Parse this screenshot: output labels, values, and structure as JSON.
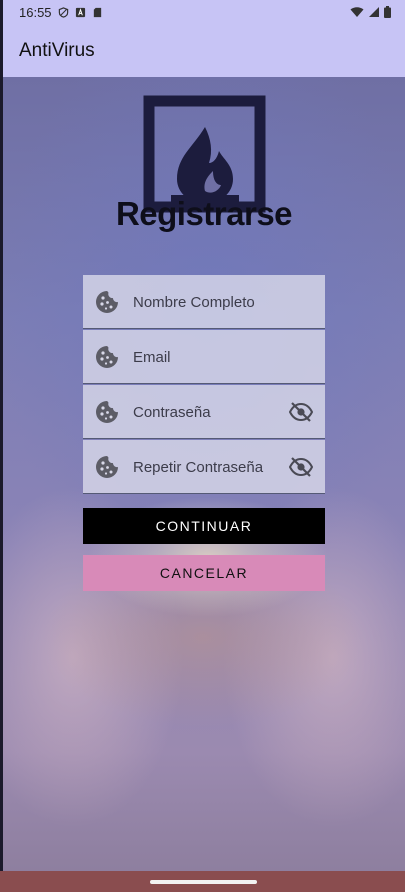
{
  "status_bar": {
    "time": "16:55",
    "left_icons": [
      "shield-icon",
      "a-box-icon",
      "sd-card-icon"
    ],
    "right_icons": [
      "wifi-icon",
      "signal-icon",
      "battery-icon"
    ]
  },
  "app_bar": {
    "title": "AntiVirus"
  },
  "logo": {
    "icon": "fire-frame-logo-icon",
    "color": "#1c1c3d"
  },
  "form": {
    "title": "Registrarse",
    "fields": [
      {
        "placeholder": "Nombre Completo",
        "value": "",
        "lead_icon": "cookie-icon"
      },
      {
        "placeholder": "Email",
        "value": "",
        "lead_icon": "cookie-icon"
      },
      {
        "placeholder": "Contraseña",
        "value": "",
        "lead_icon": "cookie-icon",
        "trail_icon": "visibility-off-icon"
      },
      {
        "placeholder": "Repetir Contraseña",
        "value": "",
        "lead_icon": "cookie-icon",
        "trail_icon": "visibility-off-icon"
      }
    ],
    "continue_label": "CONTINUAR",
    "cancel_label": "CANCELAR"
  },
  "colors": {
    "app_bar": "#c7c4f5",
    "continue_button": "#000000",
    "cancel_button": "#d88ab8",
    "nav_bar": "#8a4d4f"
  }
}
